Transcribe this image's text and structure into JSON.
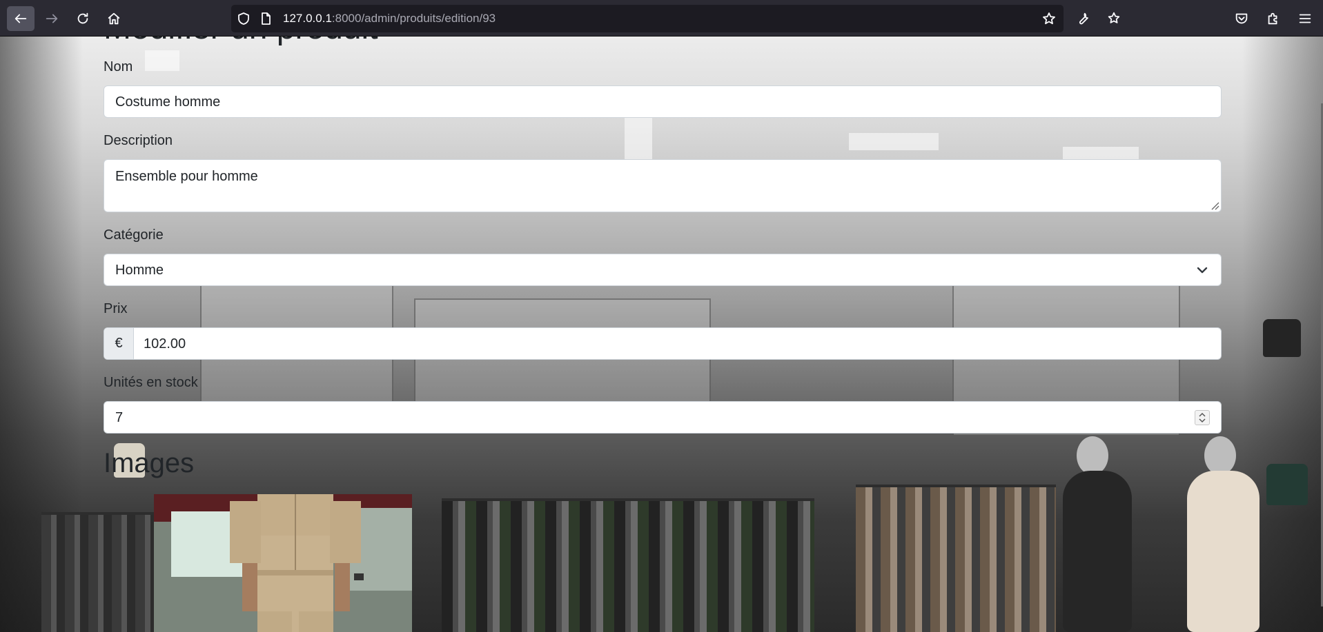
{
  "browser": {
    "url_host": "127.0.0.1",
    "url_path": ":8000/admin/produits/edition/93"
  },
  "form": {
    "title": "Modifier un produit",
    "nom_label": "Nom",
    "nom_value": "Costume homme",
    "description_label": "Description",
    "description_value": "Ensemble pour homme",
    "categorie_label": "Catégorie",
    "categorie_value": "Homme",
    "prix_label": "Prix",
    "prix_currency": "€",
    "prix_value": "102.00",
    "stock_label": "Unités en stock",
    "stock_value": "7"
  },
  "images": {
    "title": "Images"
  }
}
